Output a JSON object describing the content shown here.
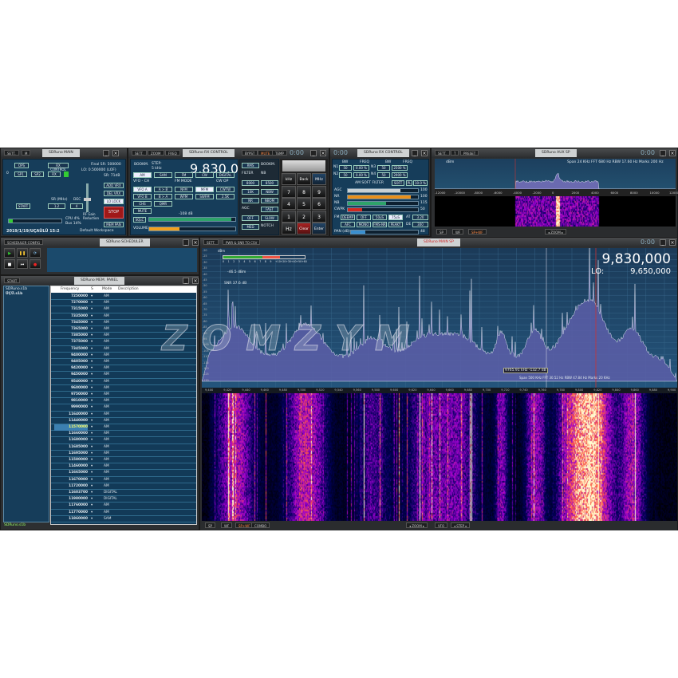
{
  "main_panel": {
    "title": "SDRuno MAIN",
    "buttons": [
      "SETT.",
      "M"
    ],
    "ops": "OPS",
    "rx_panel": "RX CONTROL",
    "sp1": "SP1",
    "sp2": "SP2",
    "rx": "RX",
    "rx_index": "0",
    "final_sr": "Final SR: 500000",
    "lo_info": "LO: 0.500000 (LOF)",
    "sr_info": "SR: 71dB",
    "start": "START",
    "sr_label": "SR (MHz)",
    "dec_label": "DEC",
    "sr_value": "1.2",
    "dec_value": "4",
    "rf_gain_label": "RF Gain Reduction",
    "add_vrx": "ADD VRX",
    "del_vrx": "DEL VRX",
    "lo_lock": "LO LOCK",
    "stop": "STOP",
    "mem_pan": "MEM PAN",
    "cpu": "CPU 4%",
    "bus": "Bus 14%",
    "datetime": "2019/1/19/UÇAÜLÜ 15:2",
    "workspace": "Default Workspace"
  },
  "rx_control": {
    "title": "SDRuno RX CONTROL",
    "buttons": [
      "SETT.",
      "ZOOM",
      "FREQ"
    ],
    "right_buttons": [
      "BYPST",
      "MUTE",
      "TEMP"
    ],
    "clock": "0:00",
    "step_label": "STEP:",
    "step_value": "5 kHz",
    "bookmark_label": "BOOKM.",
    "frequency": "9,830,000",
    "level": "-46.5 dBm",
    "rms": "RMS",
    "modes": [
      "AM",
      "SAM",
      "FM",
      "CW",
      "DIGITAL"
    ],
    "vfo_label": "VFO - CH",
    "fm_mode_label": "FM MODE",
    "cw_op": "CW OP",
    "filter_label": "FILTER",
    "nb_label": "NB",
    "notch_label": "NOTCH",
    "vfo_a": "VFO A",
    "a_to_b": "A > B",
    "nfm": "NFM",
    "mfm": "MFM",
    "cwtw": "CWTW",
    "f8000": "8000",
    "f8500": "8500",
    "nbw": "NBW",
    "nch1": "NCH1",
    "vfo_b": "VFO B",
    "b_to_a": "B > A",
    "wfm": "WFM",
    "swfm": "SWFM",
    "f2k": "2.5K",
    "f10k": "10K",
    "nbn": "NBN",
    "nch2": "NCH2",
    "chs": "CHS",
    "qmr": "QMR",
    "swapvfo": "SWAP VFO",
    "nr": "NR",
    "nbom": "NBOM",
    "nch3": "NCH3",
    "mute": "MUTE",
    "agc": "AGC",
    "nch4": "NCH4",
    "sql": "SQLC",
    "off": "OFF",
    "fast": "FAST",
    "nch5": "NCH5",
    "med": "MED",
    "slow": "SLOW",
    "volume": "VOLUME",
    "sq_level": "-108 dB",
    "volume_pct": 0.35,
    "squelch_pct": 0.95,
    "keys": [
      "kHz",
      "Back",
      "MHz",
      "7",
      "8",
      "9",
      "4",
      "5",
      "6",
      "1",
      "2",
      "3",
      "Hz",
      "Clear",
      "Enter"
    ]
  },
  "rx_control2": {
    "title": "SDRuno RX CONTROL",
    "clock": "0:00",
    "head": [
      "BW",
      "FREQ",
      "BW",
      "FREQ"
    ],
    "n1": [
      "N1",
      "50",
      "0.00 %",
      "N3",
      "50",
      "2500 %"
    ],
    "n2": [
      "N2",
      "50",
      "0.00 %",
      "N4",
      "50",
      "2900 %"
    ],
    "am_soft": "AM SOFT FILTER",
    "soft": "SOFT",
    "pl": "PL",
    "pl_val": "10.0 %",
    "bars": [
      {
        "name": "AGC",
        "value": "100",
        "pct": 0.75,
        "color": "#c8d0d4"
      },
      {
        "name": "NR",
        "value": "100",
        "pct": 0.9,
        "color": "#e8901c"
      },
      {
        "name": "NB",
        "value": "115",
        "pct": 0.55,
        "color": "#2ea36a"
      },
      {
        "name": "CWPK",
        "value": "50",
        "pct": 0.2,
        "color": "#d02a20"
      }
    ],
    "fm_buttons": [
      "DEEMP",
      "OFF",
      "50uS",
      "75uS"
    ],
    "fm_buttons2": [
      "AFC",
      "MONO",
      "FMS-NR",
      "PEAKY"
    ],
    "at": "AT",
    "at_val": "3.20",
    "de": "DE",
    "de_val": "300",
    "fm_label": "FM",
    "pan_label": "PAN (dB)",
    "pan_val": "48"
  },
  "aux_sp": {
    "title": "SDRuno AUX SP",
    "buttons": [
      "SETT.",
      "T",
      "PRESET"
    ],
    "clock": "0:00",
    "unit": "dBm",
    "info": "Span 24 KHz  FFT 680 Hz  RBW 17.60 Hz  Marks 200 Hz",
    "ticks": [
      "-12000",
      "-10000",
      "-8000",
      "-6000",
      "-4000",
      "-2000",
      "0",
      "2000",
      "4000",
      "6000",
      "8000",
      "10000",
      "12000"
    ],
    "bottom": [
      "SP",
      "WF",
      "SP+WF"
    ],
    "zoom": "ZOOM"
  },
  "scheduler": {
    "buttons": [
      "SCHEDULER CONFIG"
    ],
    "title": "SDRuno SCHEDULER"
  },
  "memory": {
    "title": "SDRuno MEM. PANEL",
    "start": "START",
    "files": [
      "SDRuno.s1b",
      "ÜÇÜ.s1b"
    ],
    "footer": "SDRuno.s1b",
    "columns": [
      "Frequency",
      "S",
      "Mode",
      "Description"
    ],
    "selected_index": 20,
    "rows": [
      [
        "7250000",
        "AM"
      ],
      [
        "7270000",
        "AM"
      ],
      [
        "7315000",
        "AM"
      ],
      [
        "7335000",
        "AM"
      ],
      [
        "7345000",
        "AM"
      ],
      [
        "7365000",
        "AM"
      ],
      [
        "7385000",
        "AM"
      ],
      [
        "7375000",
        "AM"
      ],
      [
        "7345000",
        "AM"
      ],
      [
        "9400000",
        "AM"
      ],
      [
        "9405000",
        "AM"
      ],
      [
        "9420000",
        "AM"
      ],
      [
        "9450000",
        "AM"
      ],
      [
        "9540000",
        "AM"
      ],
      [
        "9600000",
        "AM"
      ],
      [
        "9750000",
        "AM"
      ],
      [
        "9810000",
        "AM"
      ],
      [
        "9990000",
        "AM"
      ],
      [
        "11640000",
        "AM"
      ],
      [
        "11440000",
        "AM"
      ],
      [
        "11570000",
        "AM"
      ],
      [
        "11660000",
        "AM"
      ],
      [
        "11680000",
        "AM"
      ],
      [
        "11685000",
        "AM"
      ],
      [
        "11695000",
        "AM"
      ],
      [
        "11580000",
        "AM"
      ],
      [
        "11460000",
        "AM"
      ],
      [
        "11665000",
        "AM"
      ],
      [
        "11670000",
        "AM"
      ],
      [
        "11720000",
        "AM"
      ],
      [
        "11603700",
        "DIGITAL"
      ],
      [
        "11980000",
        "DIGITAL"
      ],
      [
        "11760000",
        "AM"
      ],
      [
        "11770000",
        "AM"
      ],
      [
        "11860000",
        "SAM"
      ]
    ]
  },
  "main_sp": {
    "title": "SDRuno MAIN SP",
    "buttons": [
      "SETT.",
      "PWR & SNR TO CSV"
    ],
    "clock": "0:00",
    "frequency": "9,830,000",
    "lo_label": "LO:",
    "lo_value": "9,650,000",
    "level": "-46.5 dBm",
    "snr": "SNR 37.6 dB",
    "smeter": [
      "0",
      "1",
      "2",
      "3",
      "4",
      "5",
      "6",
      "7",
      "8",
      "9",
      "+10",
      "+20",
      "+30",
      "+40",
      "+50",
      "+60"
    ],
    "cursor": "9765.91 kHz -132.7 dB",
    "info": "Span 500 KHz  FFT 30.52 Hz  RBW 47.84 Hz  Marks 20 KHz",
    "unit": "dBm",
    "db_ticks": [
      "-20",
      "-25",
      "-30",
      "-35",
      "-40",
      "-45",
      "-50",
      "-55",
      "-60",
      "-65",
      "-70",
      "-75",
      "-80",
      "-85",
      "-90",
      "-95",
      "-100",
      "-105",
      "-110",
      "-115",
      "-120",
      "-125",
      "-130"
    ],
    "freq_ticks": [
      "9,400",
      "9,420",
      "9,440",
      "9,460",
      "9,480",
      "9,500",
      "9,520",
      "9,540",
      "9,560",
      "9,580",
      "9,600",
      "9,620",
      "9,640",
      "9,660",
      "9,680",
      "9,700",
      "9,720",
      "9,740",
      "9,760",
      "9,780",
      "9,800",
      "9,820",
      "9,840",
      "9,860",
      "9,880",
      "9,900"
    ],
    "bottom": [
      "SP",
      "WF",
      "SP+WF",
      "COMBO"
    ],
    "zoom": "ZOOM",
    "vfo": "VFO",
    "step": "STEP"
  },
  "watermark": "ZOMZYM"
}
